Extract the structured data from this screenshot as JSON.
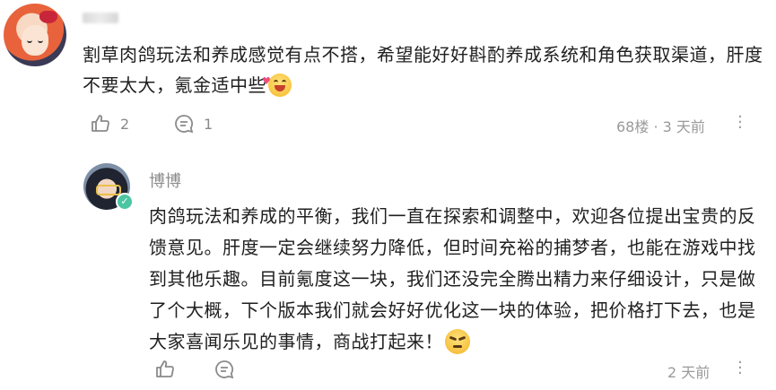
{
  "comment": {
    "text": "割草肉鸽玩法和养成感觉有点不搭，希望能好好斟酌养成系统和角色获取渠道，肝度不要太大，氪金适中些",
    "emoji": "laughing-face-emoji",
    "likes": "2",
    "replies": "1",
    "floor": "68楼",
    "separator": "·",
    "time": "3 天前"
  },
  "reply": {
    "author": "博博",
    "verified_badge": "✓",
    "text": "肉鸽玩法和养成的平衡，我们一直在探索和调整中，欢迎各位提出宝贵的反馈意见。肝度一定会继续努力降低，但时间充裕的捕梦者，也能在游戏中找到其他乐趣。目前氪度这一块，我们还没完全腾出精力来仔细设计，只是做了个大概，下个版本我们就会好好优化这一块的体验，把价格打下去，也是大家喜闻乐见的事情，商战打起来！",
    "emoji": "smirking-face-emoji",
    "time": "2 天前"
  },
  "colors": {
    "text": "#1f1f1f",
    "meta": "#9a9a9a",
    "badge": "#4cc6a2"
  }
}
